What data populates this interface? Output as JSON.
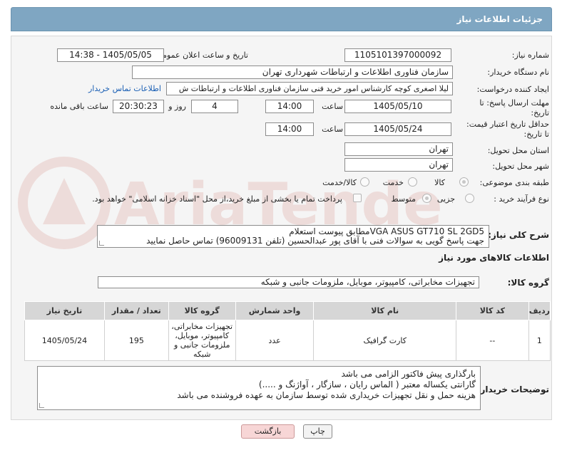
{
  "header": {
    "title": "جزئیات اطلاعات نیاز"
  },
  "fields": {
    "need_number_label": "شماره نیاز:",
    "need_number": "1105101397000092",
    "announce_label": "تاریخ و ساعت اعلان عمومی:",
    "announce_value": "1405/05/05 - 14:38",
    "buyer_org_label": "نام دستگاه خریدار:",
    "buyer_org": "سازمان فناوری اطلاعات و ارتباطات شهرداری تهران",
    "creator_label": "ایجاد کننده درخواست:",
    "creator": "لیلا اصغری کوچه کارشناس امور خرید فنی سازمان فناوری اطلاعات و ارتباطات ش",
    "buyer_contact_link": "اطلاعات تماس خریدار",
    "deadline_label_1": "مهلت ارسال پاسخ: تا",
    "deadline_label_2": "تاریخ:",
    "deadline_date": "1405/05/10",
    "time_label": "ساعت",
    "deadline_time": "14:00",
    "days_value": "4",
    "days_label": "روز و",
    "remaining_time": "20:30:23",
    "remaining_label": "ساعت باقی مانده",
    "price_validity_label_1": "حداقل تاریخ اعتبار قیمت:",
    "price_validity_label_2": "تا تاریخ:",
    "price_validity_date": "1405/05/24",
    "price_validity_time": "14:00",
    "province_label": "استان محل تحویل:",
    "province": "تهران",
    "city_label": "شهر محل تحویل:",
    "city": "تهران",
    "category_label": "طبقه بندی موضوعی:",
    "category_options": [
      "کالا",
      "خدمت",
      "کالا/خدمت"
    ],
    "process_label": "نوع فرآیند خرید :",
    "process_options": [
      "جزیی",
      "متوسط"
    ],
    "payment_note": "پرداخت تمام یا بخشی از مبلغ خرید،از محل \"اسناد خزانه اسلامی\" خواهد بود.",
    "summary_label": "شرح کلی نیاز:",
    "summary_line1": "VGA ASUS GT710 SL 2GD5مطابق پیوست استعلام",
    "summary_line2": "جهت پاسخ گویی به سوالات فنی با آقای پور عبدالحسین (تلفن 96009131) تماس حاصل نمایید",
    "goods_info_title": "اطلاعات کالاهای مورد نیاز",
    "goods_group_label": "گروه کالا:",
    "goods_group": "تجهیزات مخابراتی، کامپیوتر، موبایل، ملزومات جانبی و شبکه"
  },
  "table": {
    "headers": [
      "ردیف",
      "کد کالا",
      "نام کالا",
      "واحد شمارش",
      "گروه کالا",
      "تعداد / مقدار",
      "تاریخ نیاز"
    ],
    "rows": [
      [
        "1",
        "--",
        "کارت گرافیک",
        "عدد",
        "تجهیزات مخابراتی، کامپیوتر، موبایل، ملزومات جانبی و شبکه",
        "195",
        "1405/05/24"
      ]
    ]
  },
  "buyer_notes": {
    "label": "توضیحات خریدار:",
    "line1": "بارگذاری پیش فاکتور الزامی می باشد",
    "line2": "گارانتی یکساله معتبر ( الماس رایان ، سازگار ، آواژنگ و .....)",
    "line3": "هزینه حمل و نقل تجهیزات خریداری شده توسط سازمان به عهده فروشنده می باشد"
  },
  "buttons": {
    "print": "چاپ",
    "back": "بازگشت"
  },
  "watermark": {
    "text": "AriaTender.net"
  },
  "colors": {
    "header_bg": "#7fa6c2",
    "back_button_bg": "#f7d6d6",
    "link": "#1a5fb4"
  }
}
